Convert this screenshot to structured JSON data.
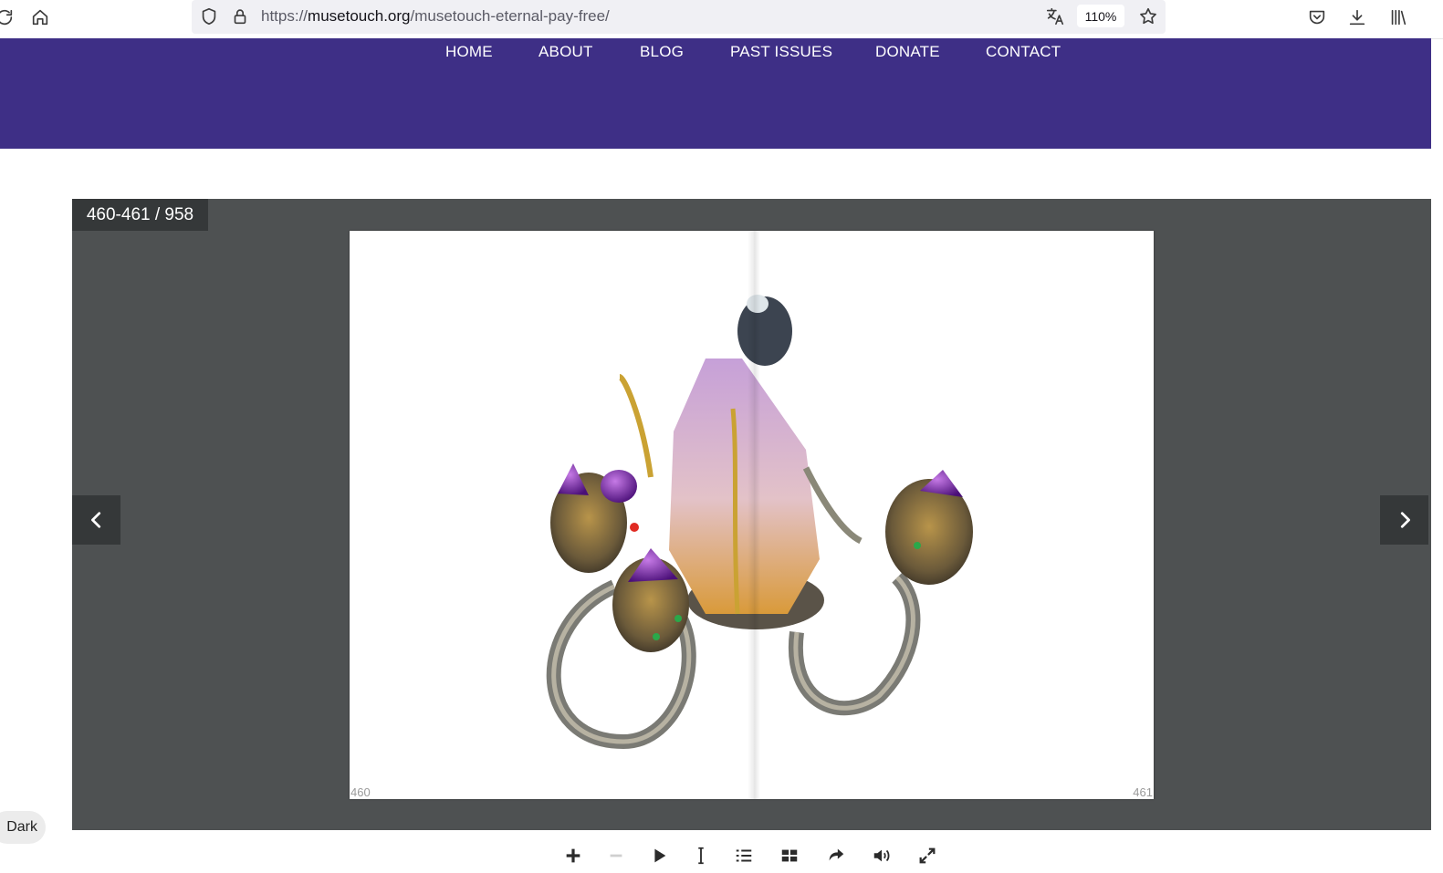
{
  "browser": {
    "url_prefix": "https://",
    "url_host": "musetouch.org",
    "url_path": "/musetouch-eternal-pay-free/",
    "zoom": "110%",
    "icons": [
      "reload-icon",
      "home-icon",
      "shield-icon",
      "lock-icon",
      "translate-icon",
      "star-icon",
      "pocket-icon",
      "download-icon",
      "library-icon"
    ]
  },
  "site": {
    "header_color": "#3e2f86",
    "nav": [
      {
        "label": "HOME"
      },
      {
        "label": "ABOUT"
      },
      {
        "label": "BLOG"
      },
      {
        "label": "PAST ISSUES"
      },
      {
        "label": "DONATE"
      },
      {
        "label": "CONTACT"
      }
    ]
  },
  "viewer": {
    "page_counter": "460-461 / 958",
    "left_page_number": "460",
    "right_page_number": "461",
    "image": "jewelry-ring-with-amethyst-crystal"
  },
  "toolbar": {
    "icons": [
      "zoom-in-icon",
      "zoom-out-icon",
      "play-icon",
      "text-select-icon",
      "table-of-contents-icon",
      "thumbnails-icon",
      "share-icon",
      "sound-icon",
      "fullscreen-icon"
    ]
  },
  "dark_mode": {
    "label": "Dark"
  }
}
